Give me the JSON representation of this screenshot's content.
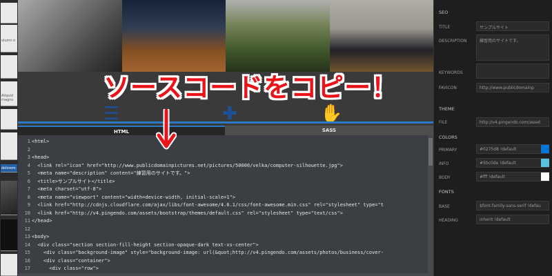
{
  "annotation": {
    "text": "ソースコードをコピー！"
  },
  "thumbs": [
    "",
    "",
    "",
    "",
    "",
    "",
    "olumn n",
    "",
    "",
    "",
    "",
    "",
    "Aliquid magnu",
    "",
    "",
    "dolorem",
    "",
    ""
  ],
  "editor": {
    "tabs": [
      "HTML",
      "SASS"
    ],
    "lines": [
      {
        "n": "1",
        "html": "&lt;html&gt;"
      },
      {
        "n": "2",
        "html": ""
      },
      {
        "n": "3",
        "html": "&lt;head&gt;"
      },
      {
        "n": "4",
        "html": "  &lt;link rel=\"icon\" href=\"http://www.publicdomainpictures.net/pictures/50000/velka/computer-silhouette.jpg\"&gt;"
      },
      {
        "n": "5",
        "html": "  &lt;meta name=\"description\" content=\"練習用のサイトです。\"&gt;"
      },
      {
        "n": "6",
        "html": "  &lt;title&gt;サンプルサイト&lt;/title&gt;"
      },
      {
        "n": "7",
        "html": "  &lt;meta charset=\"utf-8\"&gt;"
      },
      {
        "n": "8",
        "html": "  &lt;meta name=\"viewport\" content=\"width=device-width, initial-scale=1\"&gt;"
      },
      {
        "n": "9",
        "html": "  &lt;link href=\"http://cdnjs.cloudflare.com/ajax/libs/font-awesome/4.6.1/css/font-awesome.min.css\" rel=\"stylesheet\" type=\"t"
      },
      {
        "n": "10",
        "html": "  &lt;link href=\"http://v4.pingendo.com/assets/bootstrap/themes/default.css\" rel=\"stylesheet\" type=\"text/css\"&gt;"
      },
      {
        "n": "11",
        "html": "&lt;/head&gt;"
      },
      {
        "n": "12",
        "html": ""
      },
      {
        "n": "13",
        "html": "&lt;body&gt;"
      },
      {
        "n": "14",
        "html": "  &lt;div class=\"section section-fill-height section-opaque-dark text-xs-center\"&gt;"
      },
      {
        "n": "15",
        "html": "    &lt;div class=\"background-image\" style=\"background-image: url(&amp;quot;http://v4.pingendo.com/assets/photos/business/cover-"
      },
      {
        "n": "16",
        "html": "    &lt;div class=\"container\"&gt;"
      },
      {
        "n": "17",
        "html": "      &lt;div class=\"row\"&gt;"
      }
    ]
  },
  "panel": {
    "seo": "SEO",
    "title_label": "TITLE",
    "title_value": "サンプルサイト",
    "description_label": "DESCRIPTION",
    "description_value": "練習用のサイトです。",
    "keywords_label": "KEYWORDS",
    "keywords_value": "",
    "favicon_label": "FAVICON",
    "favicon_value": "http://www.publicdomainp",
    "theme": "THEME",
    "file_label": "FILE",
    "file_value": "http://v4.pingendo.com/asset",
    "colors": "COLORS",
    "primary_label": "PRIMARY",
    "primary_value": "#0275d8 !default",
    "primary_color": "#0275d8",
    "info_label": "INFO",
    "info_value": "#5bc0de !default",
    "info_color": "#5bc0de",
    "body_label": "BODY",
    "body_value": "#fff !default",
    "body_color": "#ffffff",
    "fonts": "FONTS",
    "base_label": "BASE",
    "base_value": "$font-family-sans-serif !defau",
    "heading_label": "HEADING",
    "heading_value": "inherit !default"
  }
}
